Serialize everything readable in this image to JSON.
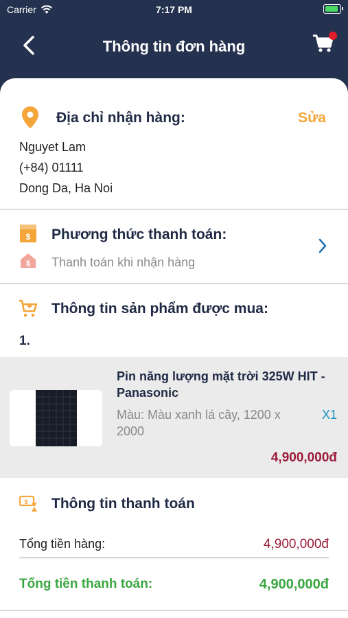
{
  "status_bar": {
    "carrier": "Carrier",
    "time": "7:17 PM"
  },
  "header": {
    "title": "Thông tin đơn hàng",
    "cart_has_badge": true
  },
  "address": {
    "title": "Địa chỉ nhận hàng:",
    "edit_label": "Sửa",
    "name": "Nguyet Lam",
    "phone": "(+84) 01111",
    "location": "Dong Da, Ha Noi"
  },
  "payment_method": {
    "title": "Phương thức thanh toán:",
    "selected": "Thanh toán khi nhận hàng"
  },
  "products": {
    "title": "Thông tin sản phẩm được mua:",
    "items": [
      {
        "index": "1.",
        "name": "Pin năng lượng mặt trời 325W HIT - Panasonic",
        "attributes": "Màu: Màu xanh lá cây, 1200 x 2000",
        "quantity": "X1",
        "price": "4,900,000đ"
      }
    ]
  },
  "payment_summary": {
    "title": "Thông tin thanh toán",
    "subtotal_label": "Tổng tiền hàng:",
    "subtotal_value": "4,900,000đ",
    "total_label": "Tổng tiền thanh toán:",
    "total_value": "4,900,000đ"
  },
  "colors": {
    "header_bg": "#24314f",
    "accent_orange": "#f4a63a",
    "price_red": "#9b1c3b",
    "total_green": "#3aa63f",
    "qty_blue": "#1a8fbf"
  }
}
